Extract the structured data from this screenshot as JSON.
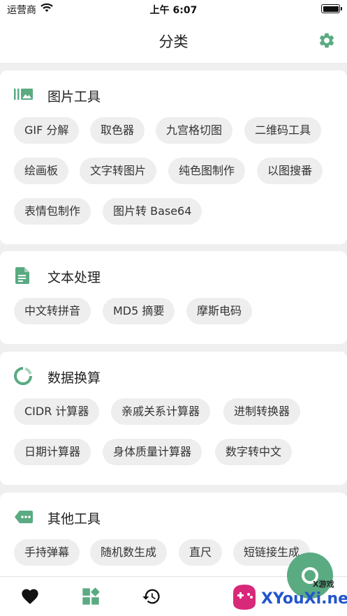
{
  "status_bar": {
    "carrier": "运营商",
    "time": "上午 6:07"
  },
  "nav": {
    "title": "分类"
  },
  "sections": [
    {
      "title": "图片工具",
      "icon": "image-tools-icon",
      "items": [
        "GIF 分解",
        "取色器",
        "九宫格切图",
        "二维码工具",
        "绘画板",
        "文字转图片",
        "纯色图制作",
        "以图搜番",
        "表情包制作",
        "图片转 Base64"
      ]
    },
    {
      "title": "文本处理",
      "icon": "document-icon",
      "items": [
        "中文转拼音",
        "MD5 摘要",
        "摩斯电码"
      ]
    },
    {
      "title": "数据换算",
      "icon": "ring-chart-icon",
      "items": [
        "CIDR 计算器",
        "亲戚关系计算器",
        "进制转换器",
        "日期计算器",
        "身体质量计算器",
        "数字转中文"
      ]
    },
    {
      "title": "其他工具",
      "icon": "tag-more-icon",
      "items": [
        "手持弹幕",
        "随机数生成",
        "直尺",
        "短链接生成"
      ]
    }
  ],
  "tab_bar": {
    "tabs": [
      "favorites-icon",
      "category-icon",
      "history-icon"
    ]
  },
  "watermark": {
    "text": "XYouXi.net",
    "sub": "X游戏"
  },
  "colors": {
    "accent": "#5aaa82",
    "chip_bg": "#eeeeee",
    "background": "#efefef"
  }
}
